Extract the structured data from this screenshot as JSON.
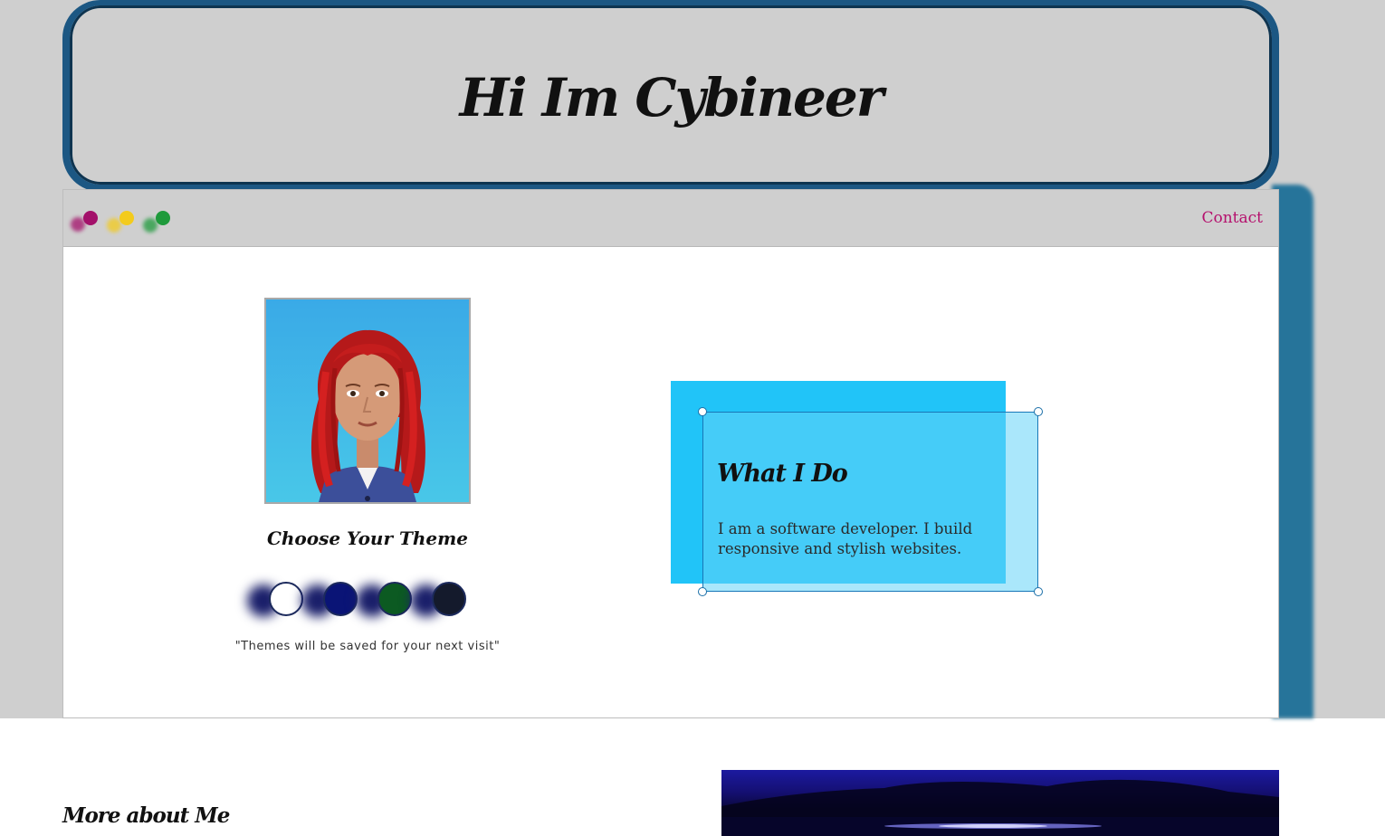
{
  "header": {
    "title": "Hi Im Cybineer"
  },
  "window_bar": {
    "dots": [
      {
        "name": "magenta-dot",
        "color": "#a3106a"
      },
      {
        "name": "yellow-dot",
        "color": "#f3cb1c"
      },
      {
        "name": "green-dot",
        "color": "#1e9a3b"
      }
    ],
    "contact_label": "Contact"
  },
  "profile": {
    "avatar_icon": "avatar-icon",
    "theme_heading": "Choose Your Theme",
    "theme_swatches": [
      {
        "name": "white",
        "color": "#ffffff"
      },
      {
        "name": "navy",
        "color": "#0a1476"
      },
      {
        "name": "green",
        "color": "#0c5a22"
      },
      {
        "name": "dark",
        "color": "#141a2c"
      }
    ],
    "theme_note": "\"Themes will be saved for your next visit\""
  },
  "what_i_do": {
    "title": "What I Do",
    "text": "I am a software developer. I build responsive and stylish websites."
  },
  "more": {
    "heading": "More about Me"
  },
  "colors": {
    "frame": "#1c5783",
    "shadow": "#26749a",
    "accent": "#b5106d",
    "card": "#21c4f8"
  }
}
